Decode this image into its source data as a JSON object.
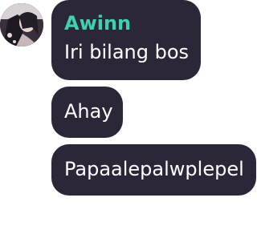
{
  "sender": {
    "name": "Awinn",
    "name_color": "#3fd0b0",
    "avatar_icon": "user-avatar-photo"
  },
  "messages": [
    {
      "text": "Iri bilang bos"
    },
    {
      "text": "Ahay"
    },
    {
      "text": "Papaalepalwplepel"
    }
  ],
  "colors": {
    "bubble_bg": "#2b2638",
    "message_text": "#ffffff"
  }
}
